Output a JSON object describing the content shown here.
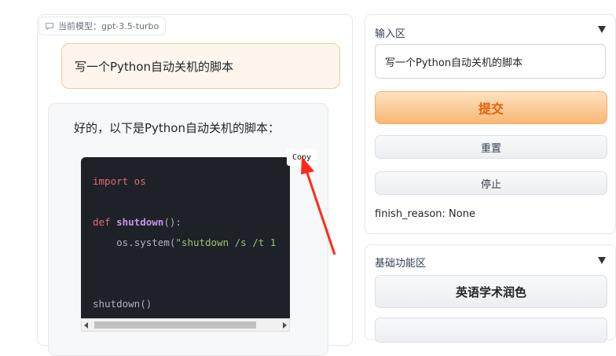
{
  "chat": {
    "model_label": "当前模型：gpt-3.5-turbo",
    "user_message": "写一个Python自动关机的脚本",
    "bot_message": "好的，以下是Python自动关机的脚本：",
    "code": {
      "line1_kw": "import os",
      "line3_kw": "def",
      "line3_fn": "shutdown",
      "line3_rest": "():",
      "line4_obj": "os",
      "line4_method": ".system(",
      "line4_str": "\"shutdown /s /t 1",
      "line6": "shutdown()"
    },
    "copy_label": "Copy"
  },
  "input_area": {
    "title": "输入区",
    "input_value": "写一个Python自动关机的脚本",
    "submit_label": "提交",
    "reset_label": "重置",
    "stop_label": "停止",
    "finish_reason": "finish_reason: None"
  },
  "basic_functions": {
    "title": "基础功能区",
    "button1_label": "英语学术润色"
  },
  "colors": {
    "accent_orange": "#e2620b",
    "annotation_red": "#ff2a1a",
    "code_bg": "#1e2127"
  }
}
